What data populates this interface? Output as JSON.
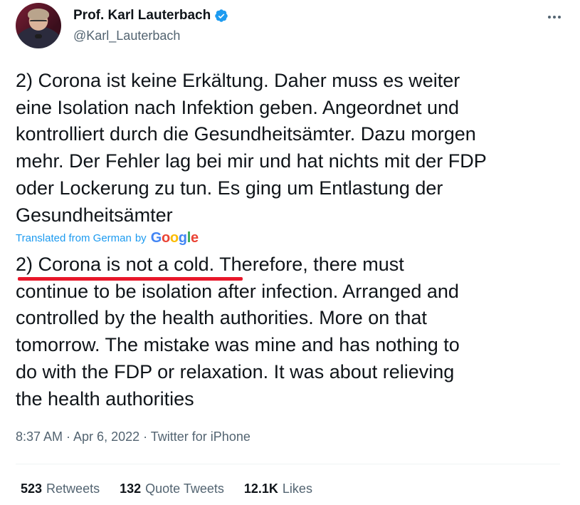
{
  "author": {
    "name": "Prof. Karl Lauterbach",
    "handle": "@Karl_Lauterbach",
    "verified_icon": "verified-badge-icon"
  },
  "tweet": {
    "text": "2) Corona ist keine Erkältung. Daher muss es weiter\neine Isolation nach Infektion geben. Angeordnet und\nkontrolliert durch die Gesundheitsämter. Dazu morgen\nmehr. Der Fehler lag bei mir und hat nichts mit der FDP\noder Lockerung zu tun. Es ging um Entlastung der\nGesundheitsämter",
    "translated_label": "Translated from German",
    "by_label": "by",
    "translation": "2) Corona is not a cold. Therefore, there must\ncontinue to be isolation after infection. Arranged and\ncontrolled by the health authorities. More on that\ntomorrow. The mistake was mine and has nothing to\ndo with the FDP or relaxation. It was about relieving\nthe health authorities",
    "timestamp": "8:37 AM · Apr 6, 2022 · Twitter for iPhone"
  },
  "google_logo": {
    "g1": "G",
    "o1": "o",
    "o2": "o",
    "g2": "g",
    "l": "l",
    "e": "e"
  },
  "stats": {
    "retweets_count": "523",
    "retweets_label": "Retweets",
    "quotes_count": "132",
    "quotes_label": "Quote Tweets",
    "likes_count": "12.1K",
    "likes_label": "Likes"
  },
  "colors": {
    "link_blue": "#1d9bf0",
    "secondary_text": "#536471",
    "annotation_red": "#e8172a"
  }
}
